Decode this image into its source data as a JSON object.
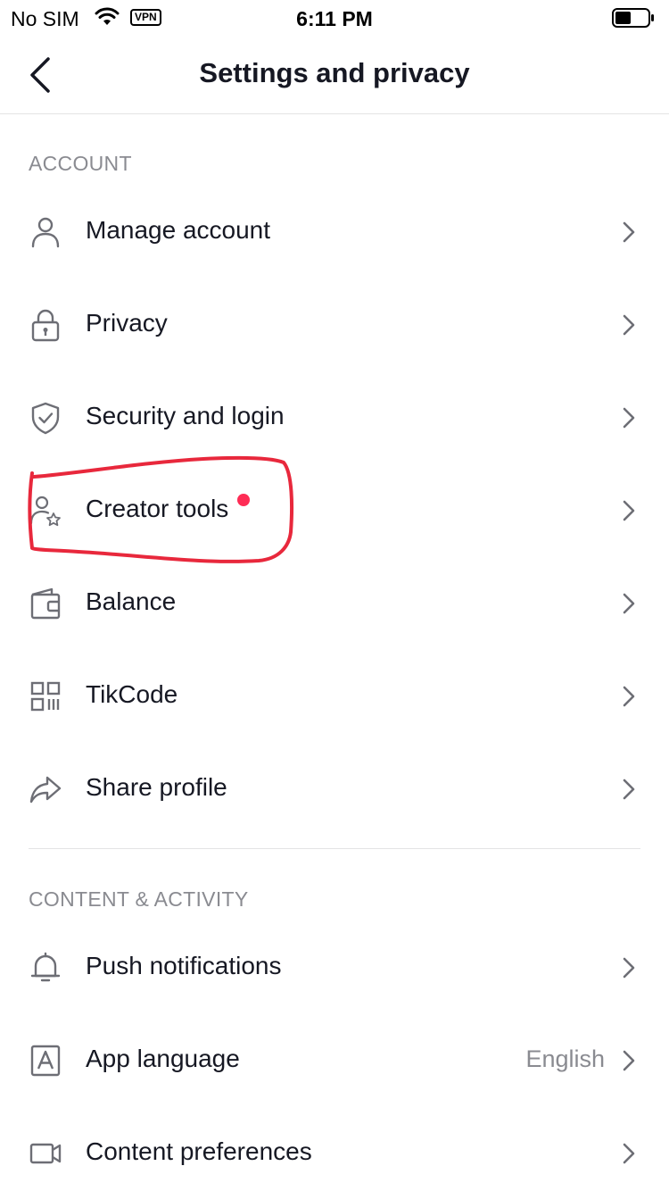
{
  "status_bar": {
    "carrier": "No SIM",
    "vpn": "VPN",
    "time": "6:11 PM"
  },
  "nav": {
    "title": "Settings and privacy",
    "back_icon": "chevron-left-icon"
  },
  "sections": {
    "account": {
      "header": "ACCOUNT",
      "items": [
        {
          "label": "Manage account",
          "icon": "person-icon"
        },
        {
          "label": "Privacy",
          "icon": "lock-icon"
        },
        {
          "label": "Security and login",
          "icon": "shield-icon"
        },
        {
          "label": "Creator tools",
          "icon": "person-star-icon",
          "has_notification_dot": true
        },
        {
          "label": "Balance",
          "icon": "wallet-icon"
        },
        {
          "label": "TikCode",
          "icon": "qr-code-icon"
        },
        {
          "label": "Share profile",
          "icon": "share-icon"
        }
      ]
    },
    "content_activity": {
      "header": "CONTENT & ACTIVITY",
      "items": [
        {
          "label": "Push notifications",
          "icon": "bell-icon"
        },
        {
          "label": "App language",
          "icon": "language-icon",
          "value": "English"
        },
        {
          "label": "Content preferences",
          "icon": "video-camera-icon"
        }
      ]
    }
  },
  "colors": {
    "text_primary": "#161823",
    "text_secondary": "#8a8b91",
    "icon": "#6d6e75",
    "notification_dot": "#fe2c55",
    "annotation": "#e8283c"
  }
}
